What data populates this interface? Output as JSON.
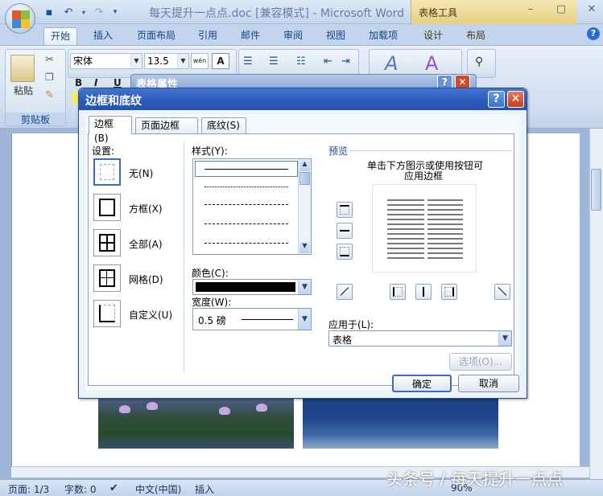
{
  "title_bar": {
    "document_title": "每天提升一点点.doc [兼容模式] - Microsoft Word",
    "contextual_header": "表格工具",
    "minimize": "–",
    "maximize": "▢",
    "close": "✕"
  },
  "ribbon_tabs": [
    "开始",
    "插入",
    "页面布局",
    "引用",
    "邮件",
    "审阅",
    "视图",
    "加载项",
    "设计",
    "布局"
  ],
  "active_tab": "开始",
  "help": "?",
  "ribbon": {
    "clipboard": {
      "paste_label": "粘贴",
      "group_label": "剪贴板"
    },
    "font": {
      "font_name": "宋体",
      "font_size": "13.5",
      "wen": "wén",
      "bold": "B",
      "italic": "I",
      "underline": "U"
    }
  },
  "property_dialog": {
    "title": "表格属性",
    "help": "?",
    "close": "✕"
  },
  "dialog": {
    "title": "边框和底纹",
    "help_btn": "?",
    "close_btn": "✕",
    "tabs": [
      "边框(B)",
      "页面边框(P)",
      "底纹(S)"
    ],
    "settings_label": "设置:",
    "settings": [
      "无(N)",
      "方框(X)",
      "全部(A)",
      "网格(D)",
      "自定义(U)"
    ],
    "style_label": "样式(Y):",
    "color_label": "颜色(C):",
    "width_label": "宽度(W):",
    "width_value": "0.5 磅",
    "preview_label": "预览",
    "preview_hint_1": "单击下方图示或使用按钮可",
    "preview_hint_2": "应用边框",
    "apply_to_label": "应用于(L):",
    "apply_to_value": "表格",
    "options_btn": "选项(O)...",
    "ok_btn": "确定",
    "cancel_btn": "取消"
  },
  "status_bar": {
    "page": "页面: 1/3",
    "words": "字数: 0",
    "language": "中文(中国)",
    "mode": "插入",
    "zoom": "90%"
  },
  "watermark": "头条号 / 每天提升一点点"
}
